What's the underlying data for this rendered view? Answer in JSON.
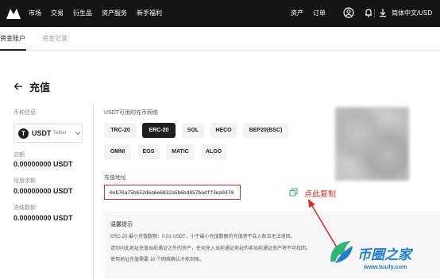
{
  "nav": {
    "items": [
      "市场",
      "交易",
      "衍生品",
      "资产服务",
      "新手福利"
    ],
    "right_items": [
      "资产",
      "订单"
    ],
    "language": "简体中文/USD"
  },
  "subtabs": [
    "资金账户",
    "资金记录"
  ],
  "page": {
    "title": "充值"
  },
  "left": {
    "coin_label": "币种信息",
    "coin": {
      "symbol": "USDT",
      "name": "Tether",
      "icon_glyph": "T"
    },
    "total_label": "总额",
    "total_value": "0.00000000 USDT",
    "available_label": "可用余额",
    "available_value": "0.00000000 USDT",
    "frozen_label": "冻结数额",
    "frozen_value": "0.00000000 USDT"
  },
  "network": {
    "label": "USDT可用的充币网络",
    "chips": [
      "TRC-20",
      "ERC-20",
      "SOL",
      "HECO",
      "BEP20(BSC)",
      "OMNI",
      "EOS",
      "MATIC",
      "ALGO"
    ],
    "selected": "ERC-20"
  },
  "address": {
    "label": "充值地址",
    "value": "0xb70a75b652d6a6e6832a5b6bd857badff3ea9370",
    "copy_hint": "点此复制"
  },
  "tips": {
    "title": "温馨提示",
    "lines": [
      "ERC-20 最小充值数额：0.01 USDT，小于最小充值数额的充值将不会入账且无法退回。",
      "请勿向此地址充值当前通证之外的资产，任何充入当前通证地址的非当前通证资产将不可找回。",
      "使用地址充值需要 16 个网络确认才能到账。"
    ]
  },
  "watermark": {
    "name": "币圈之家",
    "url": "www.tuufy.com"
  },
  "colors": {
    "accent": "#1f1f1f",
    "highlight": "#d93025",
    "watermark": "#1e7fd0"
  }
}
